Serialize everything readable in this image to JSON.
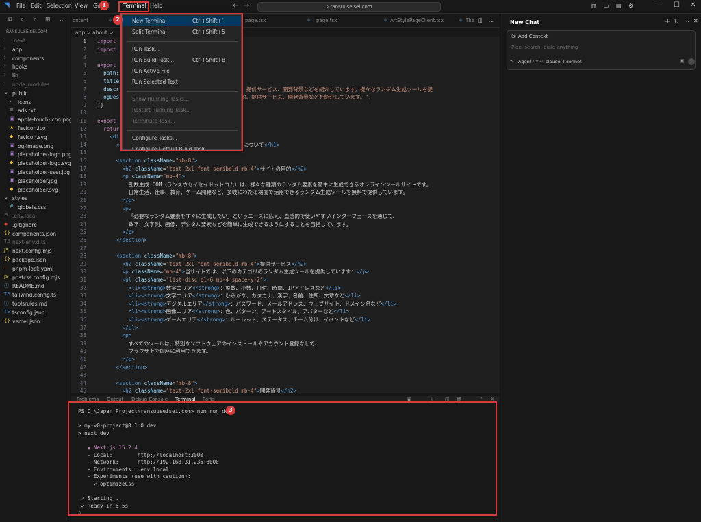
{
  "titlebar": {
    "menus": [
      "File",
      "Edit",
      "Selection",
      "View",
      "Go",
      "Run",
      "Terminal",
      "Help"
    ],
    "search": "ransuuseisei.com",
    "controls": [
      "—",
      "☐",
      "✕"
    ]
  },
  "explorer": {
    "project": "RANSUUSEISEI.COM",
    "files": [
      {
        "name": ".next",
        "type": "folder",
        "depth": 0,
        "dim": true
      },
      {
        "name": "app",
        "type": "folder",
        "depth": 0
      },
      {
        "name": "components",
        "type": "folder",
        "depth": 0
      },
      {
        "name": "hooks",
        "type": "folder",
        "depth": 0
      },
      {
        "name": "lib",
        "type": "folder",
        "depth": 0
      },
      {
        "name": "node_modules",
        "type": "folder",
        "depth": 0,
        "dim": true
      },
      {
        "name": "public",
        "type": "folder-open",
        "depth": 0
      },
      {
        "name": "icons",
        "type": "folder",
        "depth": 1
      },
      {
        "name": "ads.txt",
        "type": "txt",
        "depth": 1
      },
      {
        "name": "apple-touch-icon.png",
        "type": "img",
        "depth": 1
      },
      {
        "name": "favicon.ico",
        "type": "star",
        "depth": 1
      },
      {
        "name": "favicon.svg",
        "type": "svg",
        "depth": 1
      },
      {
        "name": "og-image.png",
        "type": "img",
        "depth": 1
      },
      {
        "name": "placeholder-logo.png",
        "type": "img",
        "depth": 1
      },
      {
        "name": "placeholder-logo.svg",
        "type": "svg",
        "depth": 1
      },
      {
        "name": "placeholder-user.jpg",
        "type": "img",
        "depth": 1
      },
      {
        "name": "placeholder.jpg",
        "type": "img",
        "depth": 1
      },
      {
        "name": "placeholder.svg",
        "type": "svg",
        "depth": 1
      },
      {
        "name": "styles",
        "type": "folder-open",
        "depth": 0
      },
      {
        "name": "globals.css",
        "type": "css",
        "depth": 1
      },
      {
        "name": ".env.local",
        "type": "env",
        "depth": 0,
        "dim": true
      },
      {
        "name": ".gitignore",
        "type": "git",
        "depth": 0
      },
      {
        "name": "components.json",
        "type": "json",
        "depth": 0
      },
      {
        "name": "next-env.d.ts",
        "type": "ts",
        "depth": 0,
        "dim": true
      },
      {
        "name": "next.config.mjs",
        "type": "js",
        "depth": 0
      },
      {
        "name": "package.json",
        "type": "json",
        "depth": 0
      },
      {
        "name": "pnpm-lock.yaml",
        "type": "yaml",
        "depth": 0
      },
      {
        "name": "postcss.config.mjs",
        "type": "js",
        "depth": 0
      },
      {
        "name": "README.md",
        "type": "md",
        "depth": 0
      },
      {
        "name": "tailwind.config.ts",
        "type": "ts",
        "depth": 0
      },
      {
        "name": "toolsrules.md",
        "type": "md",
        "depth": 0
      },
      {
        "name": "tsconfig.json",
        "type": "ts",
        "depth": 0
      },
      {
        "name": "vercel.json",
        "type": "json",
        "depth": 0
      }
    ]
  },
  "tabs": [
    "ontent",
    "page.tsx",
    "page.tsx",
    "ArtStylePageClient.tsx",
    "The"
  ],
  "breadcrumb": "app > about >",
  "editor": {
    "lines": [
      {
        "n": "1",
        "segs": [
          [
            "kw",
            "import"
          ]
        ]
      },
      {
        "n": "2",
        "segs": [
          [
            "kw",
            "import"
          ],
          [
            "tx",
            "                              "
          ],
          [
            "st",
            "Metadata\""
          ]
        ]
      },
      {
        "n": "3",
        "segs": []
      },
      {
        "n": "4",
        "segs": [
          [
            "kw",
            "export"
          ],
          [
            "tx",
            "                            "
          ],
          [
            "at",
            "geMetadata({"
          ]
        ]
      },
      {
        "n": "5",
        "segs": [
          [
            "tx",
            "  "
          ],
          [
            "at",
            "path:"
          ]
        ]
      },
      {
        "n": "6",
        "segs": [
          [
            "tx",
            "  "
          ],
          [
            "at",
            "title"
          ]
        ]
      },
      {
        "n": "7",
        "segs": [
          [
            "tx",
            "  "
          ],
          [
            "at",
            "descr"
          ],
          [
            "tx",
            "                        "
          ],
          [
            "st",
            "説。当サイトの目的、提供サービス、開発背景などを紹介しています。様々なランダム生成ツールを提"
          ]
        ]
      },
      {
        "n": "8",
        "segs": [
          [
            "tx",
            "  "
          ],
          [
            "at",
            "ogDes"
          ],
          [
            "tx",
            "                        "
          ],
          [
            "st",
            "情報。当サイトの目的、提供サービス、開発背景などを紹介しています。\","
          ]
        ]
      },
      {
        "n": "9",
        "segs": [
          [
            "tx",
            "})"
          ]
        ]
      },
      {
        "n": "10",
        "segs": []
      },
      {
        "n": "11",
        "segs": [
          [
            "kw",
            "export"
          ]
        ]
      },
      {
        "n": "12",
        "segs": [
          [
            "tx",
            "  "
          ],
          [
            "kw",
            "retur"
          ]
        ]
      },
      {
        "n": "13",
        "segs": [
          [
            "tx",
            "    "
          ],
          [
            "tg",
            "<di"
          ]
        ]
      },
      {
        "n": "14",
        "segs": [
          [
            "tx",
            "      "
          ],
          [
            "tg",
            "<"
          ],
          [
            "tx",
            "                         "
          ],
          [
            "st",
            "-6\""
          ],
          [
            "tg",
            ">"
          ],
          [
            "tx",
            "乱数生成.COMについて"
          ],
          [
            "tg",
            "</h1>"
          ]
        ]
      },
      {
        "n": "15",
        "segs": []
      },
      {
        "n": "16",
        "segs": [
          [
            "tx",
            "      "
          ],
          [
            "tg",
            "<section"
          ],
          [
            "tx",
            " "
          ],
          [
            "at",
            "className"
          ],
          [
            "tx",
            "="
          ],
          [
            "st",
            "\"mb-8\""
          ],
          [
            "tg",
            ">"
          ]
        ]
      },
      {
        "n": "17",
        "segs": [
          [
            "tx",
            "        "
          ],
          [
            "tg",
            "<h2"
          ],
          [
            "tx",
            " "
          ],
          [
            "at",
            "className"
          ],
          [
            "tx",
            "="
          ],
          [
            "st",
            "\"text-2xl font-semibold mb-4\""
          ],
          [
            "tg",
            ">"
          ],
          [
            "tx",
            "サイトの目的"
          ],
          [
            "tg",
            "</h2>"
          ]
        ]
      },
      {
        "n": "18",
        "segs": [
          [
            "tx",
            "        "
          ],
          [
            "tg",
            "<p"
          ],
          [
            "tx",
            " "
          ],
          [
            "at",
            "className"
          ],
          [
            "tx",
            "="
          ],
          [
            "st",
            "\"mb-4\""
          ],
          [
            "tg",
            ">"
          ]
        ]
      },
      {
        "n": "19",
        "segs": [
          [
            "tx",
            "          乱数生成.COM（ランスウセイセイドットコム）は、様々な種類のランダム要素を簡単に生成できるオンラインツールサイトです。"
          ]
        ]
      },
      {
        "n": "20",
        "segs": [
          [
            "tx",
            "          日常生活、仕事、教育、ゲーム開発など、多岐にわたる場面で活用できるランダム生成ツールを無料で提供しています。"
          ]
        ]
      },
      {
        "n": "21",
        "segs": [
          [
            "tx",
            "        "
          ],
          [
            "tg",
            "</p>"
          ]
        ]
      },
      {
        "n": "22",
        "segs": [
          [
            "tx",
            "        "
          ],
          [
            "tg",
            "<p>"
          ]
        ]
      },
      {
        "n": "23",
        "segs": [
          [
            "tx",
            "          「必要なランダム要素をすぐに生成したい」というニーズに応え、直感的で使いやすいインターフェースを通じて、"
          ]
        ]
      },
      {
        "n": "24",
        "segs": [
          [
            "tx",
            "          数字、文字列、画像、デジタル要素などを簡単に生成できるようにすることを目指しています。"
          ]
        ]
      },
      {
        "n": "25",
        "segs": [
          [
            "tx",
            "        "
          ],
          [
            "tg",
            "</p>"
          ]
        ]
      },
      {
        "n": "26",
        "segs": [
          [
            "tx",
            "      "
          ],
          [
            "tg",
            "</section>"
          ]
        ]
      },
      {
        "n": "27",
        "segs": []
      },
      {
        "n": "28",
        "segs": [
          [
            "tx",
            "      "
          ],
          [
            "tg",
            "<section"
          ],
          [
            "tx",
            " "
          ],
          [
            "at",
            "className"
          ],
          [
            "tx",
            "="
          ],
          [
            "st",
            "\"mb-8\""
          ],
          [
            "tg",
            ">"
          ]
        ]
      },
      {
        "n": "29",
        "segs": [
          [
            "tx",
            "        "
          ],
          [
            "tg",
            "<h2"
          ],
          [
            "tx",
            " "
          ],
          [
            "at",
            "className"
          ],
          [
            "tx",
            "="
          ],
          [
            "st",
            "\"text-2xl font-semibold mb-4\""
          ],
          [
            "tg",
            ">"
          ],
          [
            "tx",
            "提供サービス"
          ],
          [
            "tg",
            "</h2>"
          ]
        ]
      },
      {
        "n": "30",
        "segs": [
          [
            "tx",
            "        "
          ],
          [
            "tg",
            "<p"
          ],
          [
            "tx",
            " "
          ],
          [
            "at",
            "className"
          ],
          [
            "tx",
            "="
          ],
          [
            "st",
            "\"mb-4\""
          ],
          [
            "tg",
            ">"
          ],
          [
            "tx",
            "当サイトでは、以下のカテゴリのランダム生成ツールを提供しています："
          ],
          [
            "tg",
            "</p>"
          ]
        ]
      },
      {
        "n": "31",
        "segs": [
          [
            "tx",
            "        "
          ],
          [
            "tg",
            "<ul"
          ],
          [
            "tx",
            " "
          ],
          [
            "at",
            "className"
          ],
          [
            "tx",
            "="
          ],
          [
            "st",
            "\"list-disc pl-6 mb-4 space-y-2\""
          ],
          [
            "tg",
            ">"
          ]
        ]
      },
      {
        "n": "32",
        "segs": [
          [
            "tx",
            "          "
          ],
          [
            "tg",
            "<li><strong>"
          ],
          [
            "tx",
            "数字エリア"
          ],
          [
            "tg",
            "</strong>"
          ],
          [
            "tx",
            "：整数、小数、日付、時間、IPアドレスなど"
          ],
          [
            "tg",
            "</li>"
          ]
        ]
      },
      {
        "n": "33",
        "segs": [
          [
            "tx",
            "          "
          ],
          [
            "tg",
            "<li><strong>"
          ],
          [
            "tx",
            "文字エリア"
          ],
          [
            "tg",
            "</strong>"
          ],
          [
            "tx",
            "：ひらがな、カタカナ、漢字、名前、住所、文章など"
          ],
          [
            "tg",
            "</li>"
          ]
        ]
      },
      {
        "n": "34",
        "segs": [
          [
            "tx",
            "          "
          ],
          [
            "tg",
            "<li><strong>"
          ],
          [
            "tx",
            "デジタルエリア"
          ],
          [
            "tg",
            "</strong>"
          ],
          [
            "tx",
            "：パスワード、メールアドレス、ウェブサイト、ドメイン名など"
          ],
          [
            "tg",
            "</li>"
          ]
        ]
      },
      {
        "n": "35",
        "segs": [
          [
            "tx",
            "          "
          ],
          [
            "tg",
            "<li><strong>"
          ],
          [
            "tx",
            "画像エリア"
          ],
          [
            "tg",
            "</strong>"
          ],
          [
            "tx",
            "：色、パターン、アートスタイル、アバターなど"
          ],
          [
            "tg",
            "</li>"
          ]
        ]
      },
      {
        "n": "36",
        "segs": [
          [
            "tx",
            "          "
          ],
          [
            "tg",
            "<li><strong>"
          ],
          [
            "tx",
            "ゲームエリア"
          ],
          [
            "tg",
            "</strong>"
          ],
          [
            "tx",
            "：ルーレット、ステータス、チーム分け、イベントなど"
          ],
          [
            "tg",
            "</li>"
          ]
        ]
      },
      {
        "n": "37",
        "segs": [
          [
            "tx",
            "        "
          ],
          [
            "tg",
            "</ul>"
          ]
        ]
      },
      {
        "n": "38",
        "segs": [
          [
            "tx",
            "        "
          ],
          [
            "tg",
            "<p>"
          ]
        ]
      },
      {
        "n": "39",
        "segs": [
          [
            "tx",
            "          すべてのツールは、特別なソフトウェアのインストールやアカウント登録なしで、"
          ]
        ]
      },
      {
        "n": "40",
        "segs": [
          [
            "tx",
            "          ブラウザ上で即座に利用できます。"
          ]
        ]
      },
      {
        "n": "41",
        "segs": [
          [
            "tx",
            "        "
          ],
          [
            "tg",
            "</p>"
          ]
        ]
      },
      {
        "n": "42",
        "segs": [
          [
            "tx",
            "      "
          ],
          [
            "tg",
            "</section>"
          ]
        ]
      },
      {
        "n": "43",
        "segs": []
      },
      {
        "n": "44",
        "segs": [
          [
            "tx",
            "      "
          ],
          [
            "tg",
            "<section"
          ],
          [
            "tx",
            " "
          ],
          [
            "at",
            "className"
          ],
          [
            "tx",
            "="
          ],
          [
            "st",
            "\"mb-8\""
          ],
          [
            "tg",
            ">"
          ]
        ]
      },
      {
        "n": "45",
        "segs": [
          [
            "tx",
            "        "
          ],
          [
            "tg",
            "<h2"
          ],
          [
            "tx",
            " "
          ],
          [
            "at",
            "className"
          ],
          [
            "tx",
            "="
          ],
          [
            "st",
            "\"text-2xl font-semibold mb-4\""
          ],
          [
            "tg",
            ">"
          ],
          [
            "tx",
            "開発背景"
          ],
          [
            "tg",
            "</h2>"
          ]
        ]
      }
    ]
  },
  "panel_tabs": [
    "Problems",
    "Output",
    "Debug Console",
    "Terminal",
    "Ports"
  ],
  "terminal": {
    "lines": [
      "PS D:\\Japan Project\\ransuuseisei.com> npm run dev",
      "",
      "> my-v0-project@0.1.0 dev",
      "> next dev",
      "",
      "   ▲ Next.js 15.2.4",
      "   - Local:        http://localhost:3000",
      "   - Network:      http://192.168.31.235:3000",
      "   - Environments: .env.local",
      "   - Experiments (use with caution):",
      "     ✓ optimizeCss",
      "",
      " ✓ Starting...",
      " ✓ Ready in 6.5s",
      "▯"
    ]
  },
  "dropdown": {
    "items": [
      {
        "label": "New Terminal",
        "shortcut": "Ctrl+Shift+`",
        "state": "selected"
      },
      {
        "label": "Split Terminal",
        "shortcut": "Ctrl+Shift+5"
      },
      {
        "sep": true
      },
      {
        "label": "Run Task..."
      },
      {
        "label": "Run Build Task...",
        "shortcut": "Ctrl+Shift+B"
      },
      {
        "label": "Run Active File"
      },
      {
        "label": "Run Selected Text"
      },
      {
        "sep": true
      },
      {
        "label": "Show Running Tasks...",
        "state": "disabled"
      },
      {
        "label": "Restart Running Task...",
        "state": "disabled"
      },
      {
        "label": "Terminate Task...",
        "state": "disabled"
      },
      {
        "sep": true
      },
      {
        "label": "Configure Tasks..."
      },
      {
        "label": "Configure Default Build Task..."
      }
    ]
  },
  "chat": {
    "title": "New Chat",
    "add_context": "Add Context",
    "placeholder": "Plan, search, build anything",
    "agent": "Agent",
    "agent_shortcut": "Ctrl+I",
    "model": "claude-4-sonnet"
  },
  "badges": [
    "1",
    "2",
    "3"
  ],
  "colors": {
    "highlight": "#d83a3a",
    "selection": "#04395e"
  }
}
